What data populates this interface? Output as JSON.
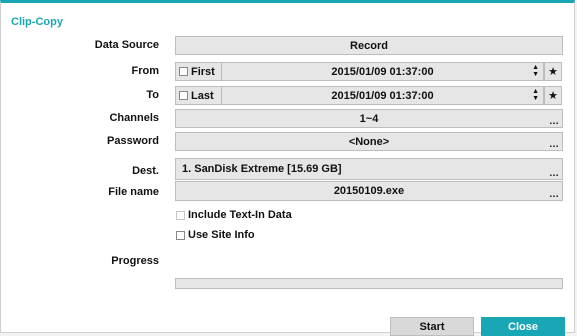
{
  "dialog": {
    "title": "Clip-Copy",
    "accent_color": "#1aa7b5"
  },
  "form": {
    "data_source": {
      "label": "Data Source",
      "value": "Record"
    },
    "from": {
      "label": "From",
      "checkbox_label": "First",
      "checked": false,
      "value": "2015/01/09  01:37:00"
    },
    "to": {
      "label": "To",
      "checkbox_label": "Last",
      "checked": false,
      "value": "2015/01/09  01:37:00"
    },
    "channels": {
      "label": "Channels",
      "value": "1~4"
    },
    "password": {
      "label": "Password",
      "value": "<None>"
    },
    "dest": {
      "label": "Dest.",
      "value": "1. SanDisk Extreme [15.69 GB]"
    },
    "file_name": {
      "label": "File name",
      "value": "20150109.exe"
    },
    "include_text_in": {
      "label": "Include Text-In Data",
      "checked": false,
      "enabled": false
    },
    "use_site_info": {
      "label": "Use Site Info",
      "checked": false
    },
    "progress": {
      "label": "Progress",
      "value": 0
    }
  },
  "buttons": {
    "start": "Start",
    "close": "Close"
  },
  "icons": {
    "spinner": "spinner-icon",
    "bookmark": "star-icon",
    "more": "ellipsis-icon"
  }
}
